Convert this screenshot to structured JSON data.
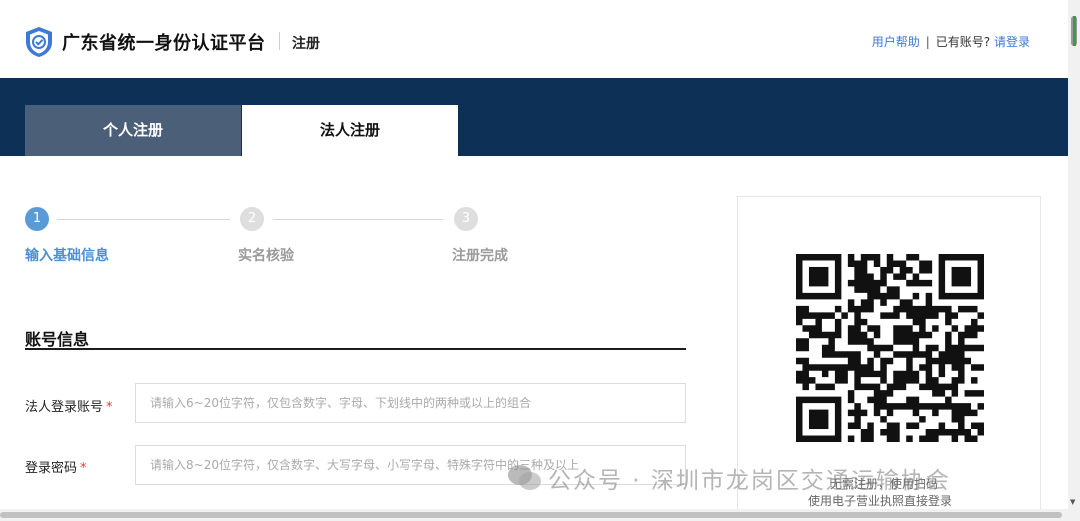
{
  "header": {
    "brand": "广东省统一身份认证平台",
    "page_tag": "注册",
    "help_link": "用户帮助",
    "has_account_text": "已有账号?",
    "login_link": "请登录",
    "separator": "|"
  },
  "tabs": [
    {
      "label": "个人注册",
      "active": false
    },
    {
      "label": "法人注册",
      "active": true
    }
  ],
  "steps": [
    {
      "number": "1",
      "label": "输入基础信息",
      "status": "active"
    },
    {
      "number": "2",
      "label": "实名核验",
      "status": "pending"
    },
    {
      "number": "3",
      "label": "注册完成",
      "status": "pending"
    }
  ],
  "account_section": {
    "title": "账号信息",
    "fields": [
      {
        "label": "法人登录账号",
        "required": "*",
        "placeholder": "请输入6~20位字符，仅包含数字、字母、下划线中的两种或以上的组合"
      },
      {
        "label": "登录密码",
        "required": "*",
        "placeholder": "请输入8~20位字符，仅含数字、大写字母、小写字母、特殊字符中的三种及以上"
      }
    ]
  },
  "qr_panel": {
    "caption_line1": "无需注册，使用扫码",
    "caption_line2": "使用电子营业执照直接登录"
  },
  "watermark": {
    "text": "公众号 · 深圳市龙岗区交通运输协会"
  },
  "colors": {
    "band": "#0d3156",
    "accent": "#3d7ad6",
    "step_active": "#5b9bd5",
    "step_pending": "#d9d9d9",
    "required": "#e23b3b"
  }
}
